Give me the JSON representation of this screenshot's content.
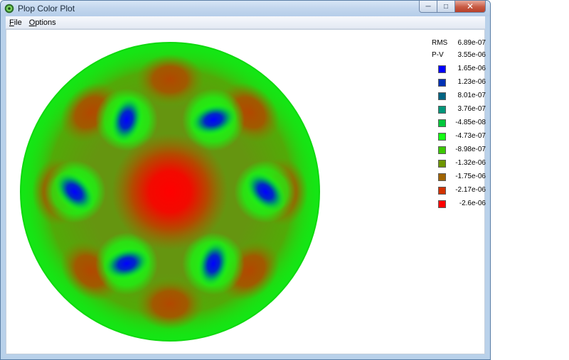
{
  "window": {
    "title": "Plop Color Plot",
    "controls": {
      "minimize": "─",
      "maximize": "□",
      "close": "✕"
    }
  },
  "menu": [
    {
      "label": "File",
      "accelerator": "F",
      "rest": "ile"
    },
    {
      "label": "Options",
      "accelerator": "O",
      "rest": "ptions"
    }
  ],
  "stats": [
    {
      "label": "RMS",
      "value": "6.89e-07"
    },
    {
      "label": "P-V",
      "value": "3.55e-06"
    }
  ],
  "legend": [
    {
      "value": "1.65e-06",
      "color": "#0000ff"
    },
    {
      "value": "1.23e-06",
      "color": "#0032b4"
    },
    {
      "value": "8.01e-07",
      "color": "#006482"
    },
    {
      "value": "3.76e-07",
      "color": "#00967a"
    },
    {
      "value": "-4.85e-08",
      "color": "#00c83c"
    },
    {
      "value": "-4.73e-07",
      "color": "#14ff14"
    },
    {
      "value": "-8.98e-07",
      "color": "#3cc800"
    },
    {
      "value": "-1.32e-06",
      "color": "#6e9600"
    },
    {
      "value": "-1.75e-06",
      "color": "#a06400"
    },
    {
      "value": "-2.17e-06",
      "color": "#d23200"
    },
    {
      "value": "-2.6e-06",
      "color": "#ff0000"
    }
  ],
  "colors": {
    "background_green": "#14e614",
    "mid_green": "#3ccf1e",
    "brown": "#a06400",
    "red": "#ff0000",
    "blue": "#0000ff"
  }
}
